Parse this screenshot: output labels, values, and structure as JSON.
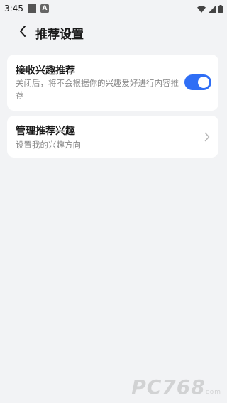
{
  "status_bar": {
    "time": "3:45",
    "notification_badge": "A",
    "icons": [
      "square-notification-icon",
      "a-notification-icon",
      "wifi-icon",
      "cellular-signal-icon",
      "battery-icon"
    ]
  },
  "header": {
    "title": "推荐设置",
    "back_icon": "chevron-left-icon"
  },
  "settings": {
    "interest_recommendation": {
      "title": "接收兴趣推荐",
      "description": "关闭后，将不会根据你的兴趣爱好进行内容推荐",
      "toggle_on": true
    },
    "manage_interests": {
      "title": "管理推荐兴趣",
      "description": "设置我的兴趣方向",
      "icon": "chevron-right-icon"
    }
  },
  "watermark": {
    "text": "PC768",
    "sub": "com"
  },
  "colors": {
    "background": "#f2f3f5",
    "card": "#ffffff",
    "accent": "#2f6ef5",
    "secondary_text": "#888888"
  }
}
